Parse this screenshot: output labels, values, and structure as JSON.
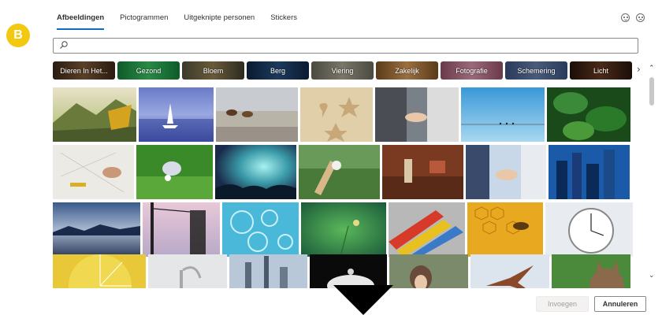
{
  "badge": {
    "letter": "B"
  },
  "tabs": [
    {
      "label": "Afbeeldingen",
      "active": true
    },
    {
      "label": "Pictogrammen",
      "active": false
    },
    {
      "label": "Uitgeknipte personen",
      "active": false
    },
    {
      "label": "Stickers",
      "active": false
    }
  ],
  "header_icons": [
    "smiley-icon",
    "frown-icon"
  ],
  "search": {
    "value": "",
    "placeholder": ""
  },
  "categories": [
    {
      "label": "Dieren In Het...",
      "color": "#3a2a1c"
    },
    {
      "label": "Gezond",
      "color": "#1f7a3a"
    },
    {
      "label": "Bloem",
      "color": "#5a4a2a"
    },
    {
      "label": "Berg",
      "color": "#152a44"
    },
    {
      "label": "Viering",
      "color": "#6a6658"
    },
    {
      "label": "Zakelijk",
      "color": "#7a5a2a"
    },
    {
      "label": "Fotografie",
      "color": "#8a5a6a"
    },
    {
      "label": "Schemering",
      "color": "#3a4a6a"
    },
    {
      "label": "Licht",
      "color": "#2a1a12"
    }
  ],
  "buttons": {
    "insert": "Invoegen",
    "cancel": "Annuleren"
  },
  "colors": {
    "accent": "#0f6cbd",
    "badge": "#f2c811"
  }
}
